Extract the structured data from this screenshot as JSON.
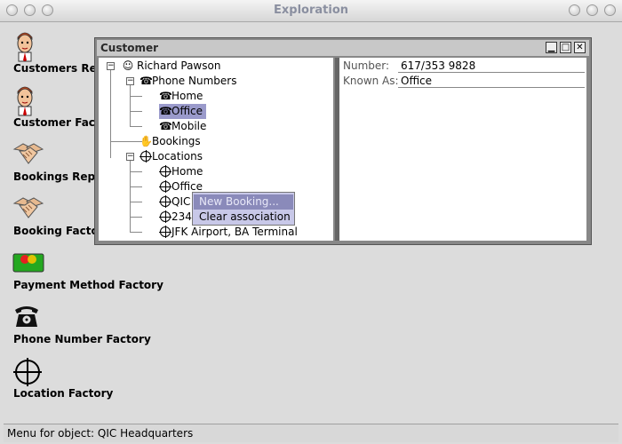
{
  "app": {
    "title": "Exploration"
  },
  "desktop": {
    "items": [
      {
        "label": "Customers Repository",
        "icon": "person-icon"
      },
      {
        "label": "Customer Factory",
        "icon": "person-icon"
      },
      {
        "label": "Bookings Repository",
        "icon": "handshake-icon"
      },
      {
        "label": "Booking Factory",
        "icon": "handshake-icon"
      },
      {
        "label": "Payment Method Factory",
        "icon": "credit-card-icon"
      },
      {
        "label": "Phone Number Factory",
        "icon": "telephone-icon"
      },
      {
        "label": "Location Factory",
        "icon": "crosshair-icon"
      }
    ]
  },
  "window": {
    "title": "Customer",
    "tree": {
      "customer": "Richard  Pawson",
      "phone_numbers": "Phone Numbers",
      "phones": [
        "Home",
        "Office",
        "Mobile"
      ],
      "bookings": "Bookings",
      "locations": "Locations",
      "location_items": [
        "Home",
        "Office",
        "QIC",
        "234",
        "JFK Airport, BA Terminal"
      ]
    },
    "properties": {
      "number_label": "Number:",
      "number_value": "617/353 9828",
      "known_as_label": "Known As:",
      "known_as_value": "Office"
    }
  },
  "context_menu": {
    "items": [
      "New Booking...",
      "Clear association"
    ]
  },
  "status": {
    "text": "Menu for object: QIC Headquarters"
  },
  "colors": {
    "selection": "#9a9acb",
    "menu": "#c8c8e8",
    "menu_highlight": "#8a8aba",
    "title_text": "#8a8fa0"
  }
}
